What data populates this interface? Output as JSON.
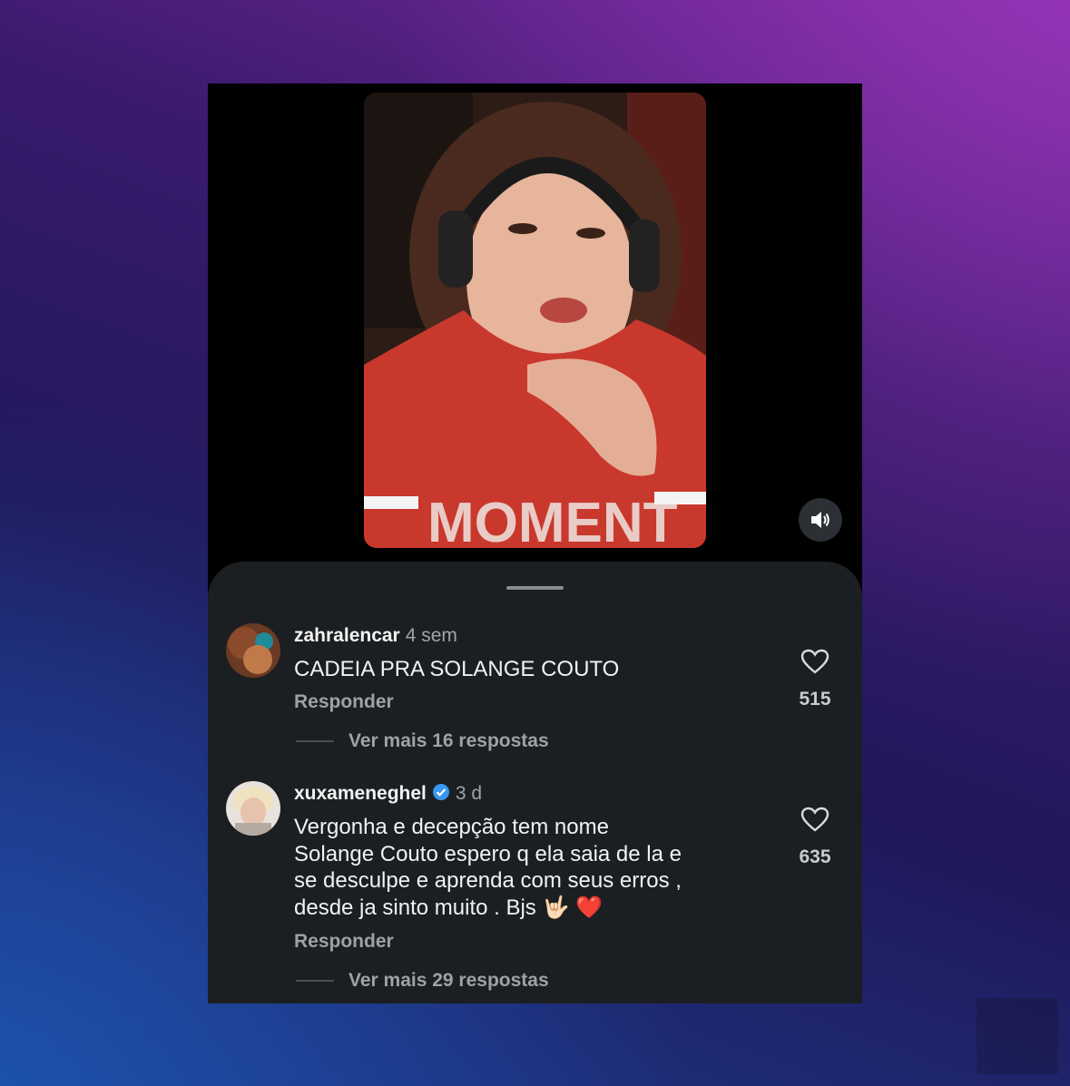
{
  "media": {
    "mute_icon": "speaker-icon"
  },
  "comments": [
    {
      "username": "zahralencar",
      "verified": false,
      "time": "4 sem",
      "text": "CADEIA PRA SOLANGE COUTO",
      "reply_label": "Responder",
      "likes": "515",
      "more_replies": "Ver mais 16 respostas"
    },
    {
      "username": "xuxameneghel",
      "verified": true,
      "time": "3 d",
      "text": "Vergonha e decepção tem nome Solange Couto espero q ela saia de la e se desculpe e aprenda com seus erros , desde ja sinto muito . Bjs 🤟🏻 ❤️",
      "reply_label": "Responder",
      "likes": "635",
      "more_replies": "Ver mais 29 respostas"
    }
  ],
  "colors": {
    "sheet": "#1b1f22",
    "verified": "#3897f0",
    "text_primary": "#f2f2f2",
    "text_secondary": "#9ea2a6"
  }
}
